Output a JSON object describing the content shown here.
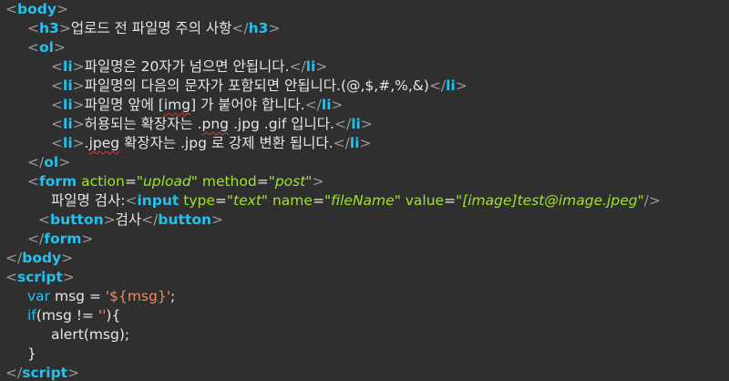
{
  "code": {
    "l1": {
      "open": "<",
      "tag": "body",
      "close": ">"
    },
    "l2": {
      "open": "<",
      "tag": "h3",
      "close": ">",
      "text": "업로드 전 파일명 주의 사항",
      "end_open": "</",
      "end_tag": "h3",
      "end_close": ">"
    },
    "l3": {
      "open": "<",
      "tag": "ol",
      "close": ">"
    },
    "li_items": [
      {
        "text_a": "파일명은 20자가 넘으면 안됩니다.",
        "text_b": "",
        "text_c": ""
      },
      {
        "text_a": "파일명의 다음의 문자가 포함되면 안됩니다.(@,$,#,%,&)",
        "text_b": "",
        "text_c": ""
      },
      {
        "text_a": "파일명 앞에 [",
        "text_b": "img",
        "text_c": "] 가 붙어야 합니다."
      },
      {
        "text_a": "허용되는 확장자는 .",
        "text_b": "png",
        "text_c": " .jpg .gif 입니다."
      },
      {
        "text_a": ".",
        "text_b": "jpeg",
        "text_c": " 확장자는 .jpg 로 강제 변환 됩니다."
      }
    ],
    "li_tag": "li",
    "l9": {
      "open": "</",
      "tag": "ol",
      "close": ">"
    },
    "l10": {
      "tag": "form",
      "attr1": "action",
      "val1": "\"upload\"",
      "attr2": "method",
      "val2": "\"post\""
    },
    "l11": {
      "label": "파일명 검사:",
      "tag": "input",
      "attr1": "type",
      "val1": "\"text\"",
      "attr2": "name",
      "val2": "\"fileName\"",
      "attr3": "value",
      "val3": "\"[image]test@image.jpeg\"",
      "selfclose": "/>"
    },
    "l12": {
      "tag": "button",
      "text": "검사"
    },
    "l13": {
      "tag": "form"
    },
    "l14": {
      "tag": "body"
    },
    "l15": {
      "tag": "script"
    },
    "l16": {
      "kw": "var",
      "rest": " msg = ",
      "str": "'${msg}'",
      "end": ";"
    },
    "l17": {
      "kw": "if",
      "rest": "(msg != ",
      "str": "''",
      "end": "){"
    },
    "l18": {
      "text": "alert(msg);"
    },
    "l19": {
      "text": "}"
    },
    "l20": {
      "tag": "script"
    }
  },
  "colors": {
    "background": "#2f2f2f",
    "tag": "#22c1ef",
    "bracket": "#9a9a9a",
    "text": "#e6e6e6",
    "attribute": "#9fe22e",
    "string": "#f08a5d"
  }
}
